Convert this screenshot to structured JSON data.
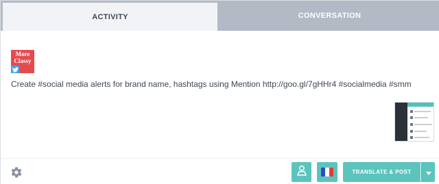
{
  "tabs": [
    {
      "label": "ACTIVITY",
      "active": true
    },
    {
      "label": "CONVERSATION",
      "active": false
    }
  ],
  "post": {
    "avatar_text": "More Classy",
    "network_icon": "twitter-icon",
    "text": "Create #social media alerts for brand name, hashtags using Mention http://goo.gl/7gHHr4 #socialmedia #smm",
    "attachment_icon": "screenshot-thumbnail"
  },
  "footer": {
    "settings_icon": "gear-icon",
    "profile_icon": "user-profile-icon",
    "language_flag": "france-flag-icon",
    "translate_label": "TRANSLATE & POST",
    "dropdown_icon": "caret-down-icon"
  },
  "colors": {
    "accent": "#5bc4bd",
    "tab_inactive": "#b3bac5",
    "avatar_red": "#e54a4f",
    "twitter_blue": "#4a9fe6"
  }
}
